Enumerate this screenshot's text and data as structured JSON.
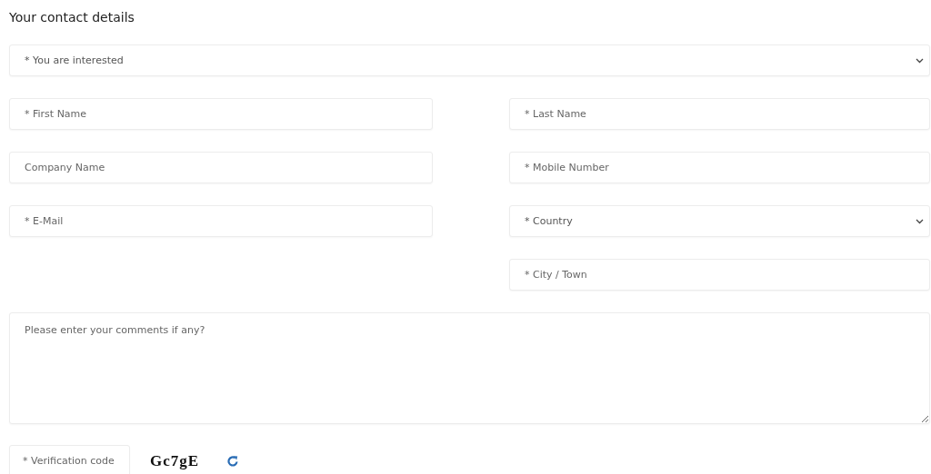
{
  "heading": "Your contact details",
  "fields": [
    {
      "kind": "select",
      "placeholder": "* You are interested"
    },
    {
      "kind": "pair",
      "left": {
        "kind": "input",
        "placeholder": "* First Name"
      },
      "right": {
        "kind": "input",
        "placeholder": "* Last Name"
      }
    },
    {
      "kind": "pair",
      "left": {
        "kind": "input",
        "placeholder": "Company Name"
      },
      "right": {
        "kind": "input",
        "placeholder": "* Mobile Number"
      }
    },
    {
      "kind": "pair",
      "left": {
        "kind": "input",
        "placeholder": "* E-Mail"
      },
      "right": {
        "kind": "select",
        "placeholder": "* Country"
      }
    },
    {
      "kind": "pair",
      "right": {
        "kind": "input",
        "placeholder": "* City / Town"
      }
    },
    {
      "kind": "textarea",
      "placeholder": "Please enter your comments if any?"
    }
  ],
  "verification": {
    "placeholder": "* Verification code",
    "captcha": "Gc7gE"
  }
}
